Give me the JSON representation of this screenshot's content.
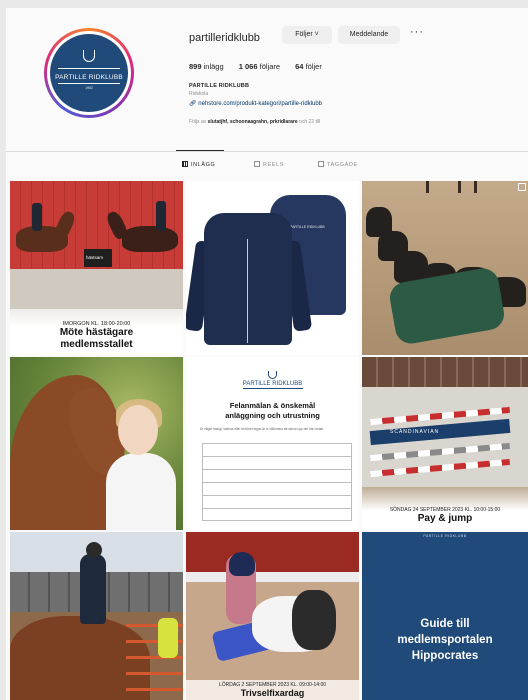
{
  "profile": {
    "username": "partilleridklubb",
    "follow_button": "Följer ˅",
    "message_button": "Meddelande",
    "more": "···",
    "stats": {
      "posts": "899",
      "posts_label": "inlägg",
      "followers": "1 066",
      "followers_label": "följare",
      "following": "64",
      "following_label": "följer"
    },
    "display_name": "PARTILLE RIDKLUBB",
    "category": "Ridskola",
    "link": "nehstore.com/produkt-kategori/partille-ridklubb",
    "followed_by_prefix": "Följs av",
    "followed_by_names": "slutatjhf, schoonaagrahn, prkridlarare",
    "followed_by_suffix": "och 22 till",
    "avatar_text": "PARTILLE RIDKLUBB",
    "avatar_year": "1962"
  },
  "tabs": [
    {
      "label": "INLÄGG"
    },
    {
      "label": "REELS"
    },
    {
      "label": "TAGGADE"
    }
  ],
  "posts": {
    "p1": {
      "date": "IMORGON KL. 18:00-20:00",
      "title1": "Möte hästägare",
      "title2": "medlemsstallet",
      "sign": "hästsam"
    },
    "p2": {
      "logo": "PARTILLE RIDKLUBB"
    },
    "p5": {
      "logo": "PARTILLE RIDKLUBB",
      "title1": "Felanmälan & önskemål",
      "title2": "anläggning och utrustning",
      "small": "Är något trasigt, saknas eller behöver lagas är ni välkomna att skriva upp det här nedan."
    },
    "p6": {
      "date": "SÖNDAG 24 SEPTEMBER 2023 KL. 10:00-15:00",
      "title": "Pay & jump",
      "sign": "SCANDINAVIAN"
    },
    "p8": {
      "date": "LÖRDAG 2 SEPTEMBER 2023 KL. 09:00-14:00",
      "title": "Trivselfixardag"
    },
    "p9": {
      "top": "PARTILLE RIDKLUBB",
      "line1": "Guide till",
      "line2": "medlemsportalen",
      "line3": "Hippocrates"
    }
  },
  "colors": {
    "brand_blue": "#1f4a7a",
    "link": "#00376b",
    "muted": "#8e8e8e"
  }
}
